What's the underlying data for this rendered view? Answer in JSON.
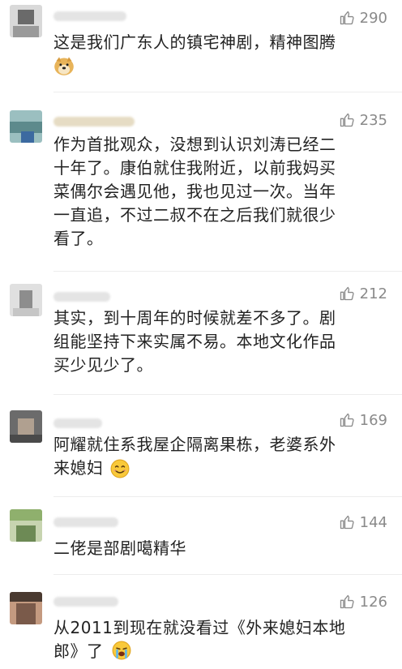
{
  "comments": [
    {
      "likes": "290",
      "text": "这是我们广东人的镇宅神剧，精神图腾",
      "emoji": "doge-emoji",
      "avatar_colors": [
        "#6a6a6a",
        "#c8c8c8",
        "#9a9a9a"
      ]
    },
    {
      "likes": "235",
      "text": "作为首批观众，没想到认识刘涛已经二\n十年了。康伯就住我附近，以前我妈买\n菜偶尔会遇见他，我也见过一次。当年\n一直追，不过二叔不在之后我们就很少\n看了。",
      "avatar_colors": [
        "#5d8a8c",
        "#3c6aa0",
        "#9bbfc0"
      ]
    },
    {
      "likes": "212",
      "text": "其实，到十周年的时候就差不多了。剧\n组能坚持下来实属不易。本地文化作品\n买少见少了。",
      "avatar_colors": [
        "#c6c6c6",
        "#8d8d8d",
        "#e0e0e0"
      ]
    },
    {
      "likes": "169",
      "text": "阿耀就住系我屋企隔离果栋，老婆系外\n来媳妇",
      "emoji": "smile-emoji",
      "avatar_colors": [
        "#6b6b6b",
        "#4a4a4a",
        "#b0a090"
      ]
    },
    {
      "likes": "144",
      "text": "二佬是部剧噶精华",
      "avatar_colors": [
        "#8fb06d",
        "#c7d4b0",
        "#6d8a55"
      ]
    },
    {
      "likes": "126",
      "text": "从2011到现在就没看过《外来媳妇本地\n郎》了",
      "emoji": "cry-emoji",
      "avatar_colors": [
        "#7a5a4a",
        "#c49a80",
        "#4a3a30"
      ]
    }
  ]
}
